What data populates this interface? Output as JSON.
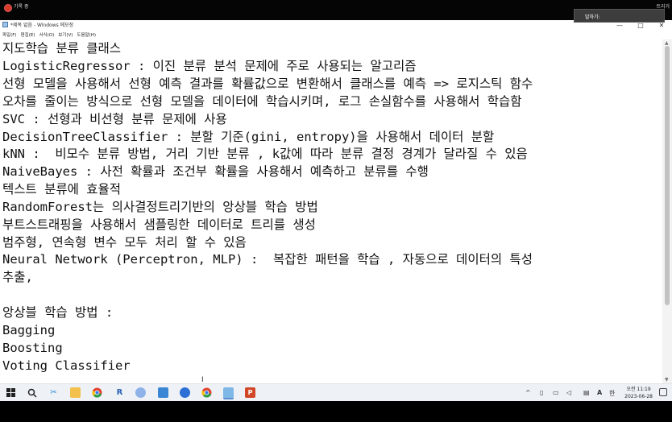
{
  "recording_bar": {
    "label": "기록 중",
    "right_label": "트리거"
  },
  "window": {
    "title": "*제목 없음 - Windows 메모장",
    "controls": {
      "minimize": "—",
      "maximize": "□",
      "close": "✕"
    }
  },
  "menu": [
    "파일(F)",
    "편집(E)",
    "서식(O)",
    "보기(V)",
    "도움말(H)"
  ],
  "popup": {
    "text": "말하기:"
  },
  "editor": {
    "lines": [
      "지도학습 분류 클래스",
      "LogisticRegressor : 이진 분류 분석 문제에 주로 사용되는 알고리즘",
      "선형 모델을 사용해서 선형 예측 결과를 확률값으로 변환해서 클래스를 예측 => 로지스틱 함수",
      "오차를 줄이는 방식으로 선형 모델을 데이터에 학습시키며, 로그 손실함수를 사용해서 학습함",
      "SVC : 선형과 비선형 분류 문제에 사용",
      "DecisionTreeClassifier : 분할 기준(gini, entropy)을 사용해서 데이터 분할",
      "kNN :  비모수 분류 방법, 거리 기반 분류 , k값에 따라 분류 결정 경계가 달라질 수 있음",
      "NaiveBayes : 사전 확률과 조건부 확률을 사용해서 예측하고 분류를 수행",
      "텍스트 분류에 효율적",
      "RandomForest는 의사결정트리기반의 앙상블 학습 방법",
      "부트스트래핑을 사용해서 샘플링한 데이터로 트리를 생성",
      "범주형, 연속형 변수 모두 처리 할 수 있음",
      "Neural Network (Perceptron, MLP) :  복잡한 패턴을 학습 , 자동으로 데이터의 특성",
      "추출,",
      "",
      "앙상블 학습 방법 :",
      "Bagging",
      "Boosting",
      "Voting Classifier"
    ],
    "cursor": "I"
  },
  "taskbar": {
    "icons": [
      "windows-start-icon",
      "search-icon",
      "snipping-icon",
      "file-explorer-icon",
      "chrome-icon",
      "r-icon",
      "app-icon",
      "remote-desktop-icon",
      "zoom-icon",
      "chrome-icon-2",
      "notepad-icon",
      "powerpoint-icon"
    ],
    "tray": {
      "chevron": "^",
      "lang_a": "A",
      "lang_han": "한"
    },
    "clock": {
      "time": "오전 11:19",
      "date": "2023-06-28"
    }
  }
}
